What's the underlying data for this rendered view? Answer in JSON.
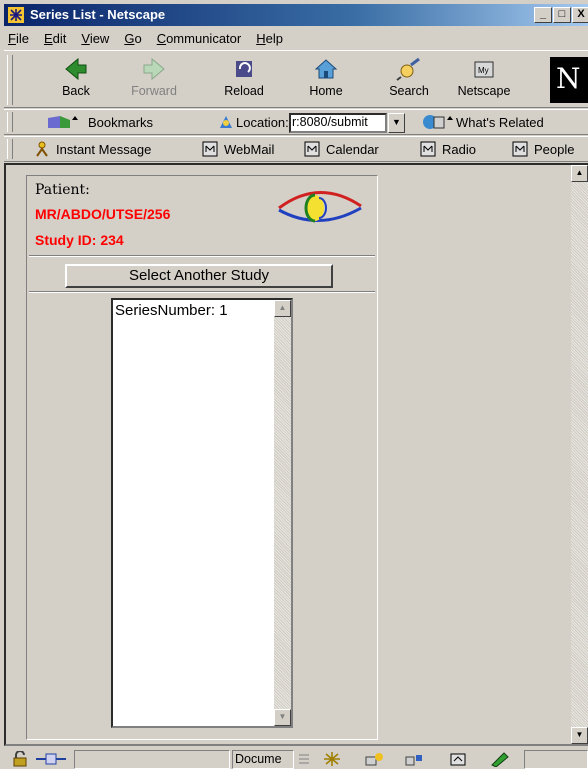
{
  "window": {
    "title": "Series List - Netscape",
    "controls": {
      "minimize": "_",
      "maximize": "□",
      "close": "X"
    }
  },
  "menu": [
    "File",
    "Edit",
    "View",
    "Go",
    "Communicator",
    "Help"
  ],
  "toolbar": {
    "back": "Back",
    "forward": "Forward",
    "reload": "Reload",
    "home": "Home",
    "search": "Search",
    "netscape": "Netscape",
    "logo": "N"
  },
  "location_bar": {
    "bookmarks": "Bookmarks",
    "location_label": "Location:",
    "url": "r:8080/submit",
    "whats_related": "What's Related"
  },
  "personal_toolbar": [
    "Instant Message",
    "WebMail",
    "Calendar",
    "Radio",
    "People"
  ],
  "page": {
    "patient_label": "Patient:",
    "patient_id": "MR/ABDO/UTSE/256",
    "study_id": "Study ID: 234",
    "select_button": "Select Another Study",
    "series_list": [
      "SeriesNumber: 1"
    ]
  },
  "statusbar": {
    "text": "Docume"
  },
  "colors": {
    "title_start": "#0a246a",
    "title_end": "#a6caf0",
    "alert_red": "#ff0000",
    "chrome": "#d4d0c8"
  }
}
